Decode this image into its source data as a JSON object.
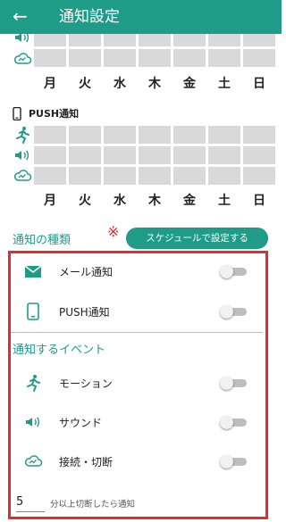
{
  "appbar": {
    "title": "通知設定",
    "back_icon": "arrow-left-icon"
  },
  "accent_color": "#1e9c88",
  "highlight_color": "#e52b2b",
  "days": [
    "月",
    "火",
    "水",
    "木",
    "金",
    "土",
    "日"
  ],
  "push_section": {
    "label": "PUSH通知",
    "icon": "phone-icon"
  },
  "notification_type": {
    "title": "通知の種類",
    "asterisk": "※",
    "schedule_button": "スケジュールで設定する",
    "items": [
      {
        "label": "メール通知",
        "icon": "mail-icon",
        "enabled": false
      },
      {
        "label": "PUSH通知",
        "icon": "phone-icon",
        "enabled": false
      }
    ]
  },
  "notification_events": {
    "title": "通知するイベント",
    "items": [
      {
        "label": "モーション",
        "icon": "running-person-icon",
        "enabled": false
      },
      {
        "label": "サウンド",
        "icon": "speaker-icon",
        "enabled": false
      },
      {
        "label": "接続・切断",
        "icon": "cloud-icon",
        "enabled": false
      }
    ]
  },
  "disconnect": {
    "value": "5",
    "label": "分以上切断したら通知"
  }
}
